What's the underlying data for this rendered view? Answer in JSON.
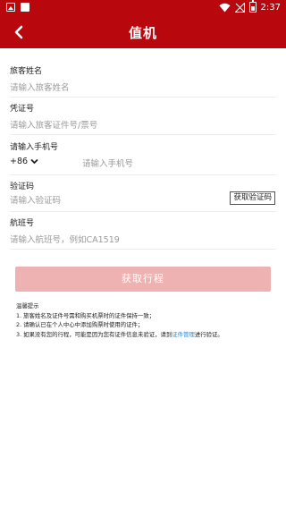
{
  "status_bar": {
    "time": "2:37",
    "icons": [
      "image-icon",
      "a-icon",
      "wifi-icon",
      "no-signal-icon",
      "battery-icon"
    ]
  },
  "header": {
    "title": "值机",
    "back_icon": "chevron-left-icon",
    "color": "#b8070d"
  },
  "form": {
    "name": {
      "label": "旅客姓名",
      "placeholder": "请输入旅客姓名"
    },
    "id": {
      "label": "凭证号",
      "placeholder": "请输入旅客证件号/票号"
    },
    "phone": {
      "label": "请输入手机号",
      "country_code": "+86",
      "placeholder": "请输入手机号"
    },
    "sms": {
      "label": "验证码",
      "placeholder": "请输入验证码",
      "button": "获取验证码"
    },
    "flight": {
      "label": "航班号",
      "placeholder": "请输入航班号，例如CA1519"
    }
  },
  "submit": {
    "label": "获取行程",
    "color": "#eeb2b2"
  },
  "tips": {
    "title": "温馨提示",
    "line1": "1. 旅客姓名及证件号需和购买机票时的证件保持一致；",
    "line2": "2. 请确认已在个人中心中添加购票时使用的证件；",
    "line3_pre": "3. 如果没有您的行程，可能是因为您有证件信息未验证，请到",
    "line3_link": "证件管理",
    "line3_post": "进行验证。",
    "link_color": "#2e87d8"
  }
}
